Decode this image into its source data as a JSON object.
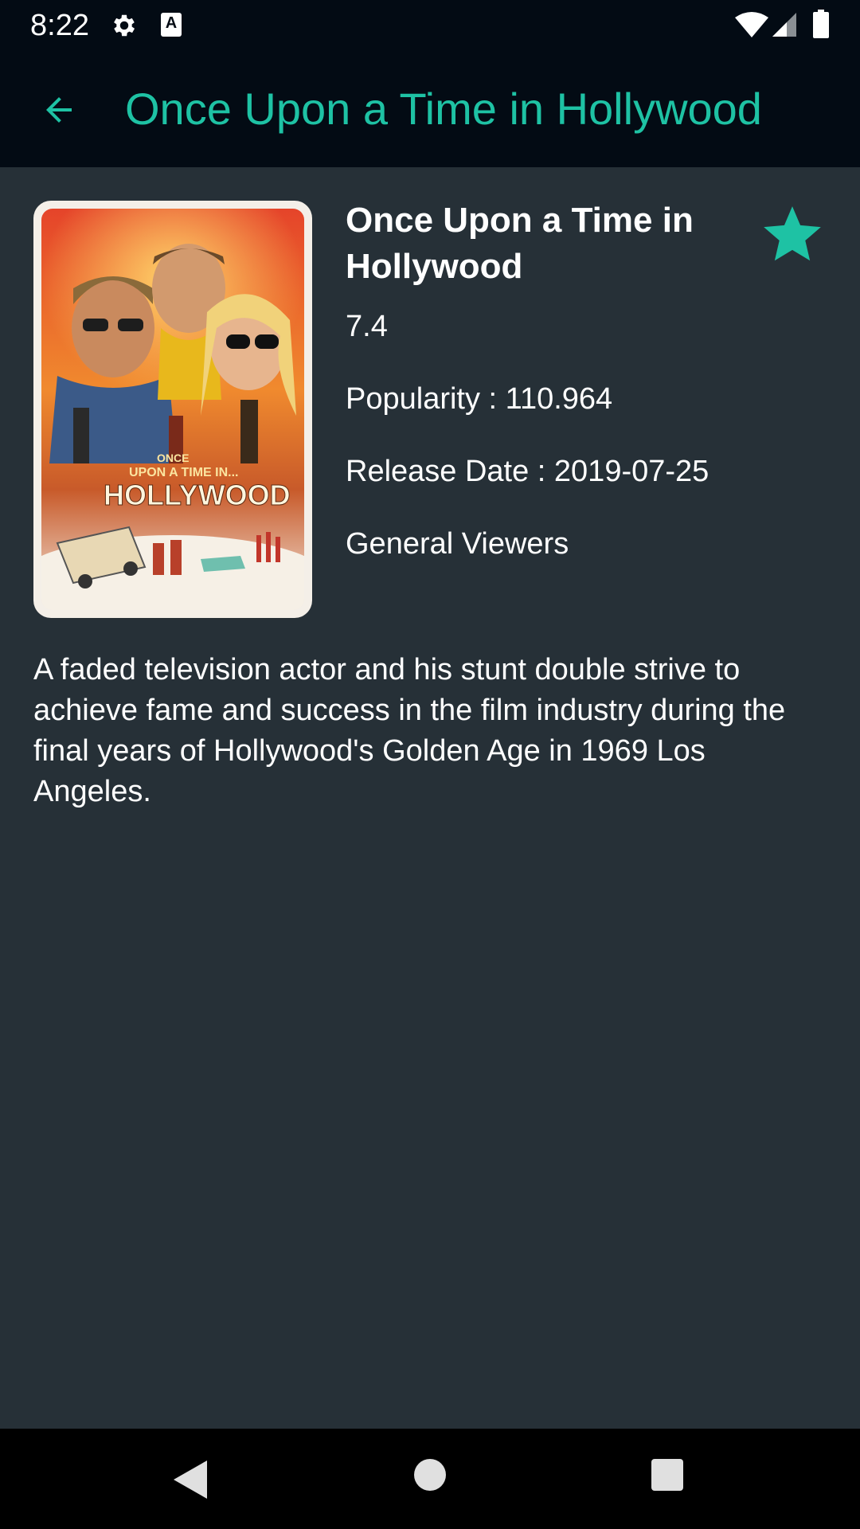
{
  "status_bar": {
    "time": "8:22",
    "icons": [
      "settings-gear-icon",
      "accessibility-a-icon",
      "wifi-icon",
      "cell-signal-icon",
      "battery-icon"
    ]
  },
  "app_bar": {
    "back_icon": "arrow-back-icon",
    "title": "Once Upon a Time in Hollywood"
  },
  "movie": {
    "poster_text": {
      "line1": "ONCE",
      "line2": "UPON A TIME IN...",
      "line3": "HOLLYWOOD"
    },
    "title": "Once Upon a Time in Hollywood",
    "rating": "7.4",
    "popularity": "Popularity : 110.964",
    "release_date": "Release Date : 2019-07-25",
    "audience": "General Viewers",
    "favorite_icon": "star-filled-icon",
    "overview": "A faded television actor and his stunt double strive to achieve fame and success in the film industry during the final years of Hollywood's Golden Age in 1969 Los Angeles."
  },
  "nav_bar": {
    "back": "nav-back-icon",
    "home": "nav-home-icon",
    "recents": "nav-recents-icon"
  },
  "colors": {
    "accent": "#1ec2a4",
    "app_bar_bg": "#030b14",
    "content_bg": "#263037",
    "nav_bg": "#000000"
  }
}
